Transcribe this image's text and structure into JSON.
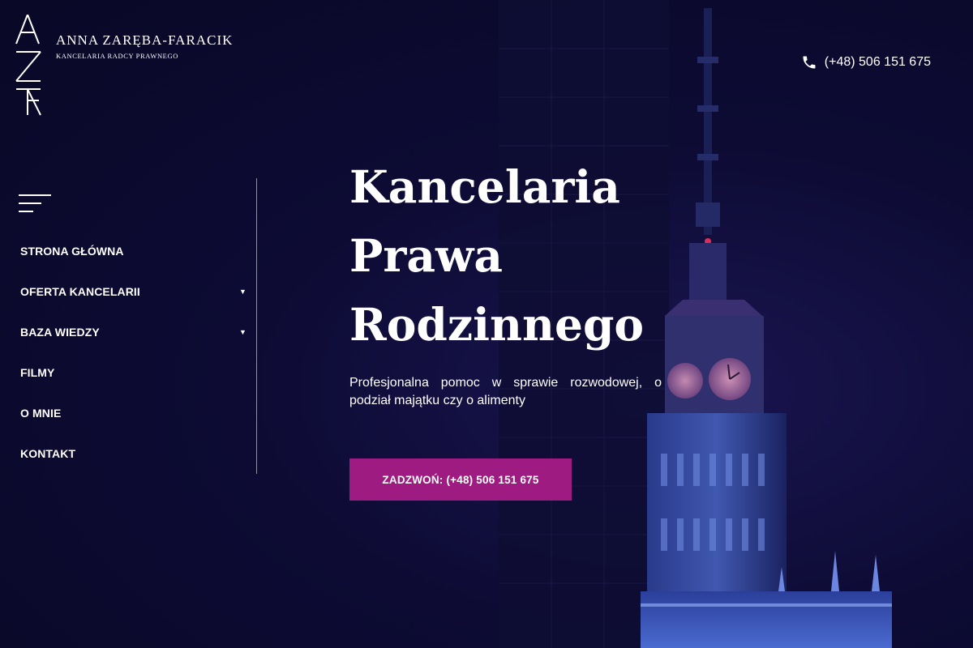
{
  "brand": {
    "name": "ANNA ZARĘBA-FARACIK",
    "subtitle": "KANCELARIA RADCY PRAWNEGO",
    "logo_icon": "azf-monogram-icon"
  },
  "header": {
    "phone": "(+48) 506 151 675",
    "phone_icon": "phone-icon"
  },
  "nav": {
    "menu_icon": "hamburger-menu-icon",
    "items": [
      {
        "label": "STRONA GŁÓWNA",
        "has_submenu": false
      },
      {
        "label": "OFERTA KANCELARII",
        "has_submenu": true
      },
      {
        "label": "BAZA WIEDZY",
        "has_submenu": true
      },
      {
        "label": "FILMY",
        "has_submenu": false
      },
      {
        "label": "O MNIE",
        "has_submenu": false
      },
      {
        "label": "KONTAKT",
        "has_submenu": false
      }
    ],
    "caret": "▼"
  },
  "hero": {
    "title_lines": [
      "Kancelaria",
      "Prawa",
      "Rodzinnego"
    ],
    "description": "Profesjonalna pomoc w sprawie rozwodowej, o podział majątku czy o alimenty",
    "cta_label": "ZADZWOŃ: (+48) 506 151 675"
  },
  "colors": {
    "background": "#0b0a2e",
    "accent": "#9e1b82",
    "text": "#ffffff"
  }
}
